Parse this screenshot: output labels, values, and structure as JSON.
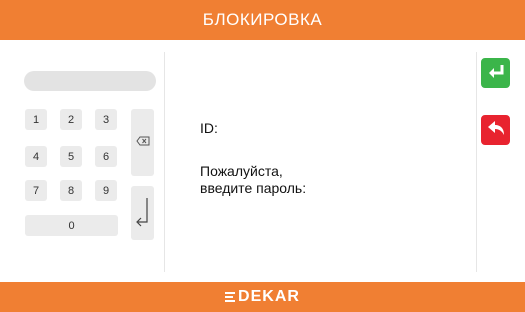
{
  "header": {
    "title": "БЛОКИРОВКА"
  },
  "keypad": {
    "keys": [
      "1",
      "2",
      "3",
      "4",
      "5",
      "6",
      "7",
      "8",
      "9",
      "0"
    ],
    "backspace_icon": "backspace-icon",
    "enter_icon": "enter-arrow-icon"
  },
  "info": {
    "id_label": "ID:",
    "prompt_line1": "Пожалуйста,",
    "prompt_line2": "введите пароль:"
  },
  "side": {
    "confirm_icon": "enter-arrow-icon",
    "back_icon": "undo-arrow-icon",
    "confirm_color": "#3bb54a",
    "back_color": "#e8232f"
  },
  "footer": {
    "brand": "DEKAR"
  },
  "colors": {
    "accent": "#f07f33"
  }
}
